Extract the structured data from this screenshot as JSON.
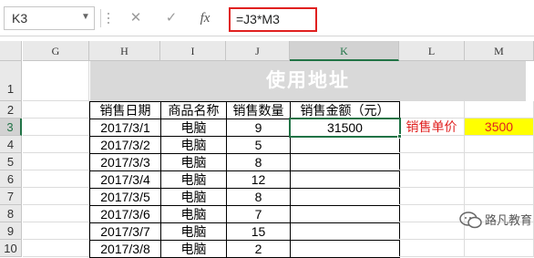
{
  "formula_bar": {
    "name_box": "K3",
    "cancel_icon": "cancel-icon",
    "enter_icon": "enter-icon",
    "function_label": "fx",
    "formula": "=J3*M3"
  },
  "columns": [
    "G",
    "H",
    "I",
    "J",
    "K",
    "L",
    "M"
  ],
  "rows": [
    "1",
    "2",
    "3",
    "4",
    "5",
    "6",
    "7",
    "8",
    "9",
    "10"
  ],
  "sheet": {
    "title": "使用地址",
    "headers": [
      "销售日期",
      "商品名称",
      "销售数量",
      "销售金额（元）"
    ],
    "data": [
      {
        "date": "2017/3/1",
        "product": "电脑",
        "qty": "9",
        "amount": "31500"
      },
      {
        "date": "2017/3/2",
        "product": "电脑",
        "qty": "5",
        "amount": ""
      },
      {
        "date": "2017/3/3",
        "product": "电脑",
        "qty": "8",
        "amount": ""
      },
      {
        "date": "2017/3/4",
        "product": "电脑",
        "qty": "12",
        "amount": ""
      },
      {
        "date": "2017/3/5",
        "product": "电脑",
        "qty": "8",
        "amount": ""
      },
      {
        "date": "2017/3/6",
        "product": "电脑",
        "qty": "7",
        "amount": ""
      },
      {
        "date": "2017/3/7",
        "product": "电脑",
        "qty": "15",
        "amount": ""
      },
      {
        "date": "2017/3/8",
        "product": "电脑",
        "qty": "2",
        "amount": ""
      }
    ],
    "unit_price_label": "销售单价",
    "unit_price_value": "3500"
  },
  "watermark": {
    "text": "路凡教育",
    "icon": "wechat-icon"
  },
  "colors": {
    "accent": "#217346",
    "highlight_red": "#e0201f",
    "yellow": "#ffff00",
    "title_bg": "#d9d9d9"
  }
}
